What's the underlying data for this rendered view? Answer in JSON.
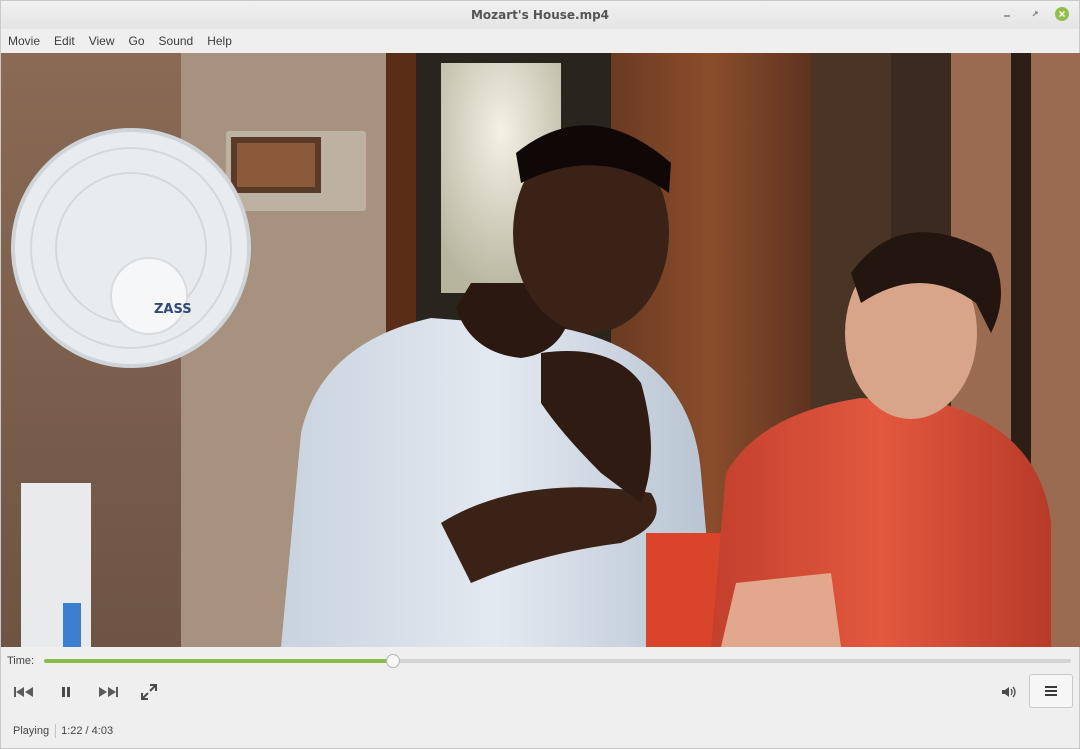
{
  "window": {
    "title": "Mozart's House.mp4",
    "controls": [
      "minimize-icon",
      "maximize-icon",
      "close-icon"
    ]
  },
  "menubar": {
    "items": [
      {
        "label": "Movie"
      },
      {
        "label": "Edit"
      },
      {
        "label": "View"
      },
      {
        "label": "Go"
      },
      {
        "label": "Sound"
      },
      {
        "label": "Help"
      }
    ]
  },
  "video": {
    "fan_brand": "ZASS"
  },
  "timeline": {
    "label": "Time:",
    "progress": 0.34,
    "accent_color": "#8cbb4a"
  },
  "controls": {
    "buttons": [
      "skip-back-icon",
      "pause-icon",
      "skip-forward-icon",
      "fullscreen-icon"
    ],
    "right": [
      "volume-icon",
      "hamburger-menu-icon"
    ]
  },
  "status": {
    "state": "Playing",
    "time": "1:22 / 4:03"
  }
}
